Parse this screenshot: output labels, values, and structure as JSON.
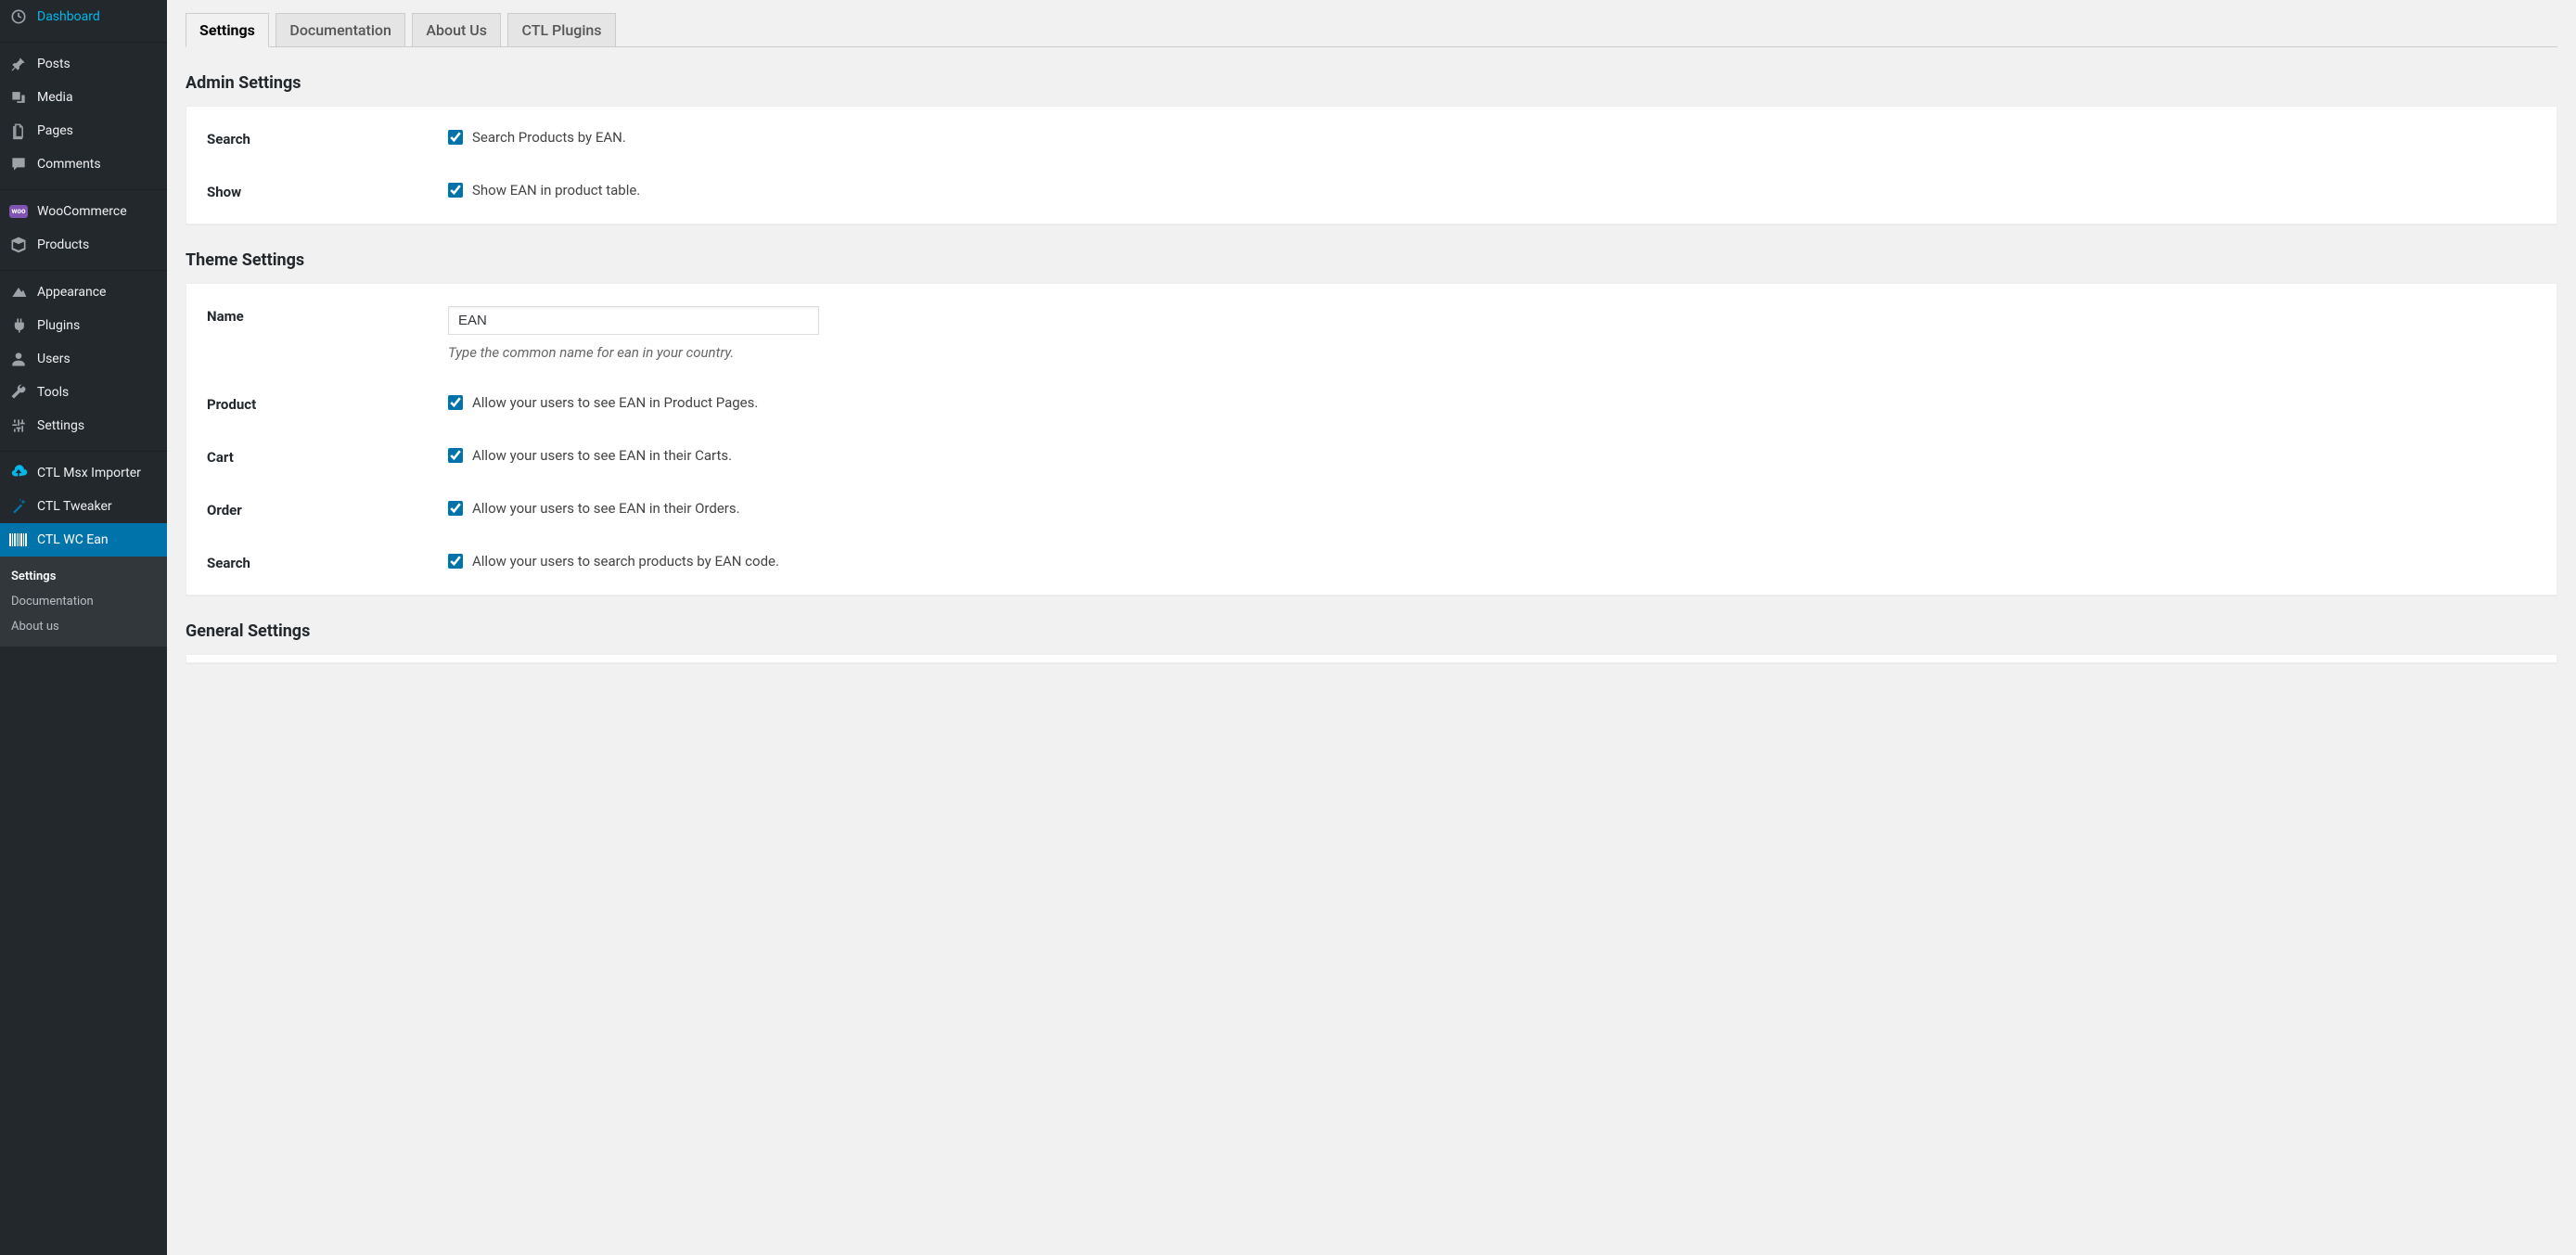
{
  "sidebar": {
    "items": [
      {
        "label": "Dashboard",
        "icon": "dashboard"
      },
      {
        "label": "Posts",
        "icon": "pin"
      },
      {
        "label": "Media",
        "icon": "media"
      },
      {
        "label": "Pages",
        "icon": "pages"
      },
      {
        "label": "Comments",
        "icon": "comments"
      },
      {
        "label": "WooCommerce",
        "icon": "woo"
      },
      {
        "label": "Products",
        "icon": "products"
      },
      {
        "label": "Appearance",
        "icon": "appearance"
      },
      {
        "label": "Plugins",
        "icon": "plugins"
      },
      {
        "label": "Users",
        "icon": "users"
      },
      {
        "label": "Tools",
        "icon": "tools"
      },
      {
        "label": "Settings",
        "icon": "settings"
      },
      {
        "label": "CTL Msx Importer",
        "icon": "cloud"
      },
      {
        "label": "CTL Tweaker",
        "icon": "wand"
      },
      {
        "label": "CTL WC Ean",
        "icon": "barcode"
      }
    ],
    "submenu": [
      {
        "label": "Settings"
      },
      {
        "label": "Documentation"
      },
      {
        "label": "About us"
      }
    ]
  },
  "tabs": [
    {
      "label": "Settings"
    },
    {
      "label": "Documentation"
    },
    {
      "label": "About Us"
    },
    {
      "label": "CTL Plugins"
    }
  ],
  "sections": {
    "admin": {
      "title": "Admin Settings",
      "search": {
        "label": "Search",
        "checkbox_label": "Search Products by EAN."
      },
      "show": {
        "label": "Show",
        "checkbox_label": "Show EAN in product table."
      }
    },
    "theme": {
      "title": "Theme Settings",
      "name": {
        "label": "Name",
        "value": "EAN",
        "desc": "Type the common name for ean in your country."
      },
      "product": {
        "label": "Product",
        "checkbox_label": "Allow your users to see EAN in Product Pages."
      },
      "cart": {
        "label": "Cart",
        "checkbox_label": "Allow your users to see EAN in their Carts."
      },
      "order": {
        "label": "Order",
        "checkbox_label": "Allow your users to see EAN in their Orders."
      },
      "search": {
        "label": "Search",
        "checkbox_label": "Allow your users to search products by EAN code."
      }
    },
    "general": {
      "title": "General Settings"
    }
  }
}
